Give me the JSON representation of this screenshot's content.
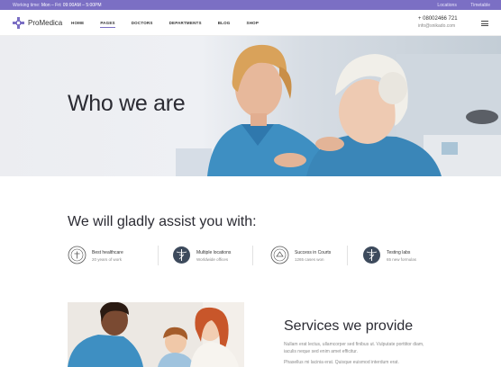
{
  "topbar": {
    "working_label": "Working time:",
    "working_hours": "Mon – Fri: 09:00AM – 5:00PM",
    "links": [
      "Locations",
      "Timetable"
    ]
  },
  "header": {
    "logo_text": "ProMedica",
    "nav": [
      "HOME",
      "PAGES",
      "DOCTORS",
      "DEPARTMENTS",
      "BLOG",
      "SHOP"
    ],
    "active_nav": "PAGES",
    "phone": "+ 08002466 721",
    "email": "info@snikado.com"
  },
  "hero": {
    "title": "Who we are"
  },
  "assist": {
    "title": "We will gladly assist you with:",
    "features": [
      {
        "title": "Best healthcare",
        "subtitle": "20 years of work",
        "icon": "seal-icon"
      },
      {
        "title": "Multiple locations",
        "subtitle": "Worldwide offices",
        "icon": "caduceus-icon"
      },
      {
        "title": "Success in Courts",
        "subtitle": "1265 cases won",
        "icon": "seal-icon"
      },
      {
        "title": "Testing labs",
        "subtitle": "65 new formulas",
        "icon": "caduceus-icon"
      }
    ]
  },
  "services": {
    "title": "Services we provide",
    "text1": "Nullam erat lectus, ullamcorper sed finibus ut. Vulputate porttitor diam, iaculis neque sed enim amet efficitur.",
    "text2": "Phasellus mi lacinia erat. Quisque euismod interdum erat."
  },
  "colors": {
    "accent": "#7b6fc4",
    "heading": "#2b2b33"
  }
}
